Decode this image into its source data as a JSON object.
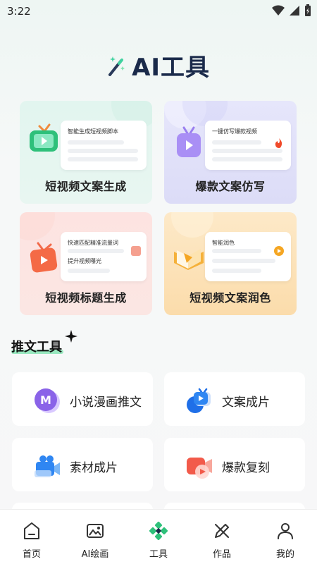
{
  "status_bar": {
    "time": "3:22"
  },
  "header": {
    "title": "AI工具"
  },
  "feature_cards": [
    {
      "label": "短视频文案生成",
      "doc_title": "智能生成短视频脚本"
    },
    {
      "label": "爆款文案仿写",
      "doc_title": "一键仿写爆款视频"
    },
    {
      "label": "短视频标题生成",
      "doc_title": "快速匹配精准流量词",
      "doc_subtitle": "提升视频曝光"
    },
    {
      "label": "短视频文案润色",
      "doc_title": "智能润色"
    }
  ],
  "section": {
    "title": "推文工具"
  },
  "tools": [
    {
      "label": "小说漫画推文",
      "icon": "M"
    },
    {
      "label": "文案成片"
    },
    {
      "label": "素材成片"
    },
    {
      "label": "爆款复刻"
    }
  ],
  "bottom_nav": [
    {
      "label": "首页",
      "icon": "home-icon"
    },
    {
      "label": "AI绘画",
      "icon": "image-icon"
    },
    {
      "label": "工具",
      "icon": "tools-icon",
      "active": true
    },
    {
      "label": "作品",
      "icon": "works-icon"
    },
    {
      "label": "我的",
      "icon": "profile-icon"
    }
  ],
  "colors": {
    "accent": "#2ec07a",
    "title": "#1a2a4a"
  }
}
